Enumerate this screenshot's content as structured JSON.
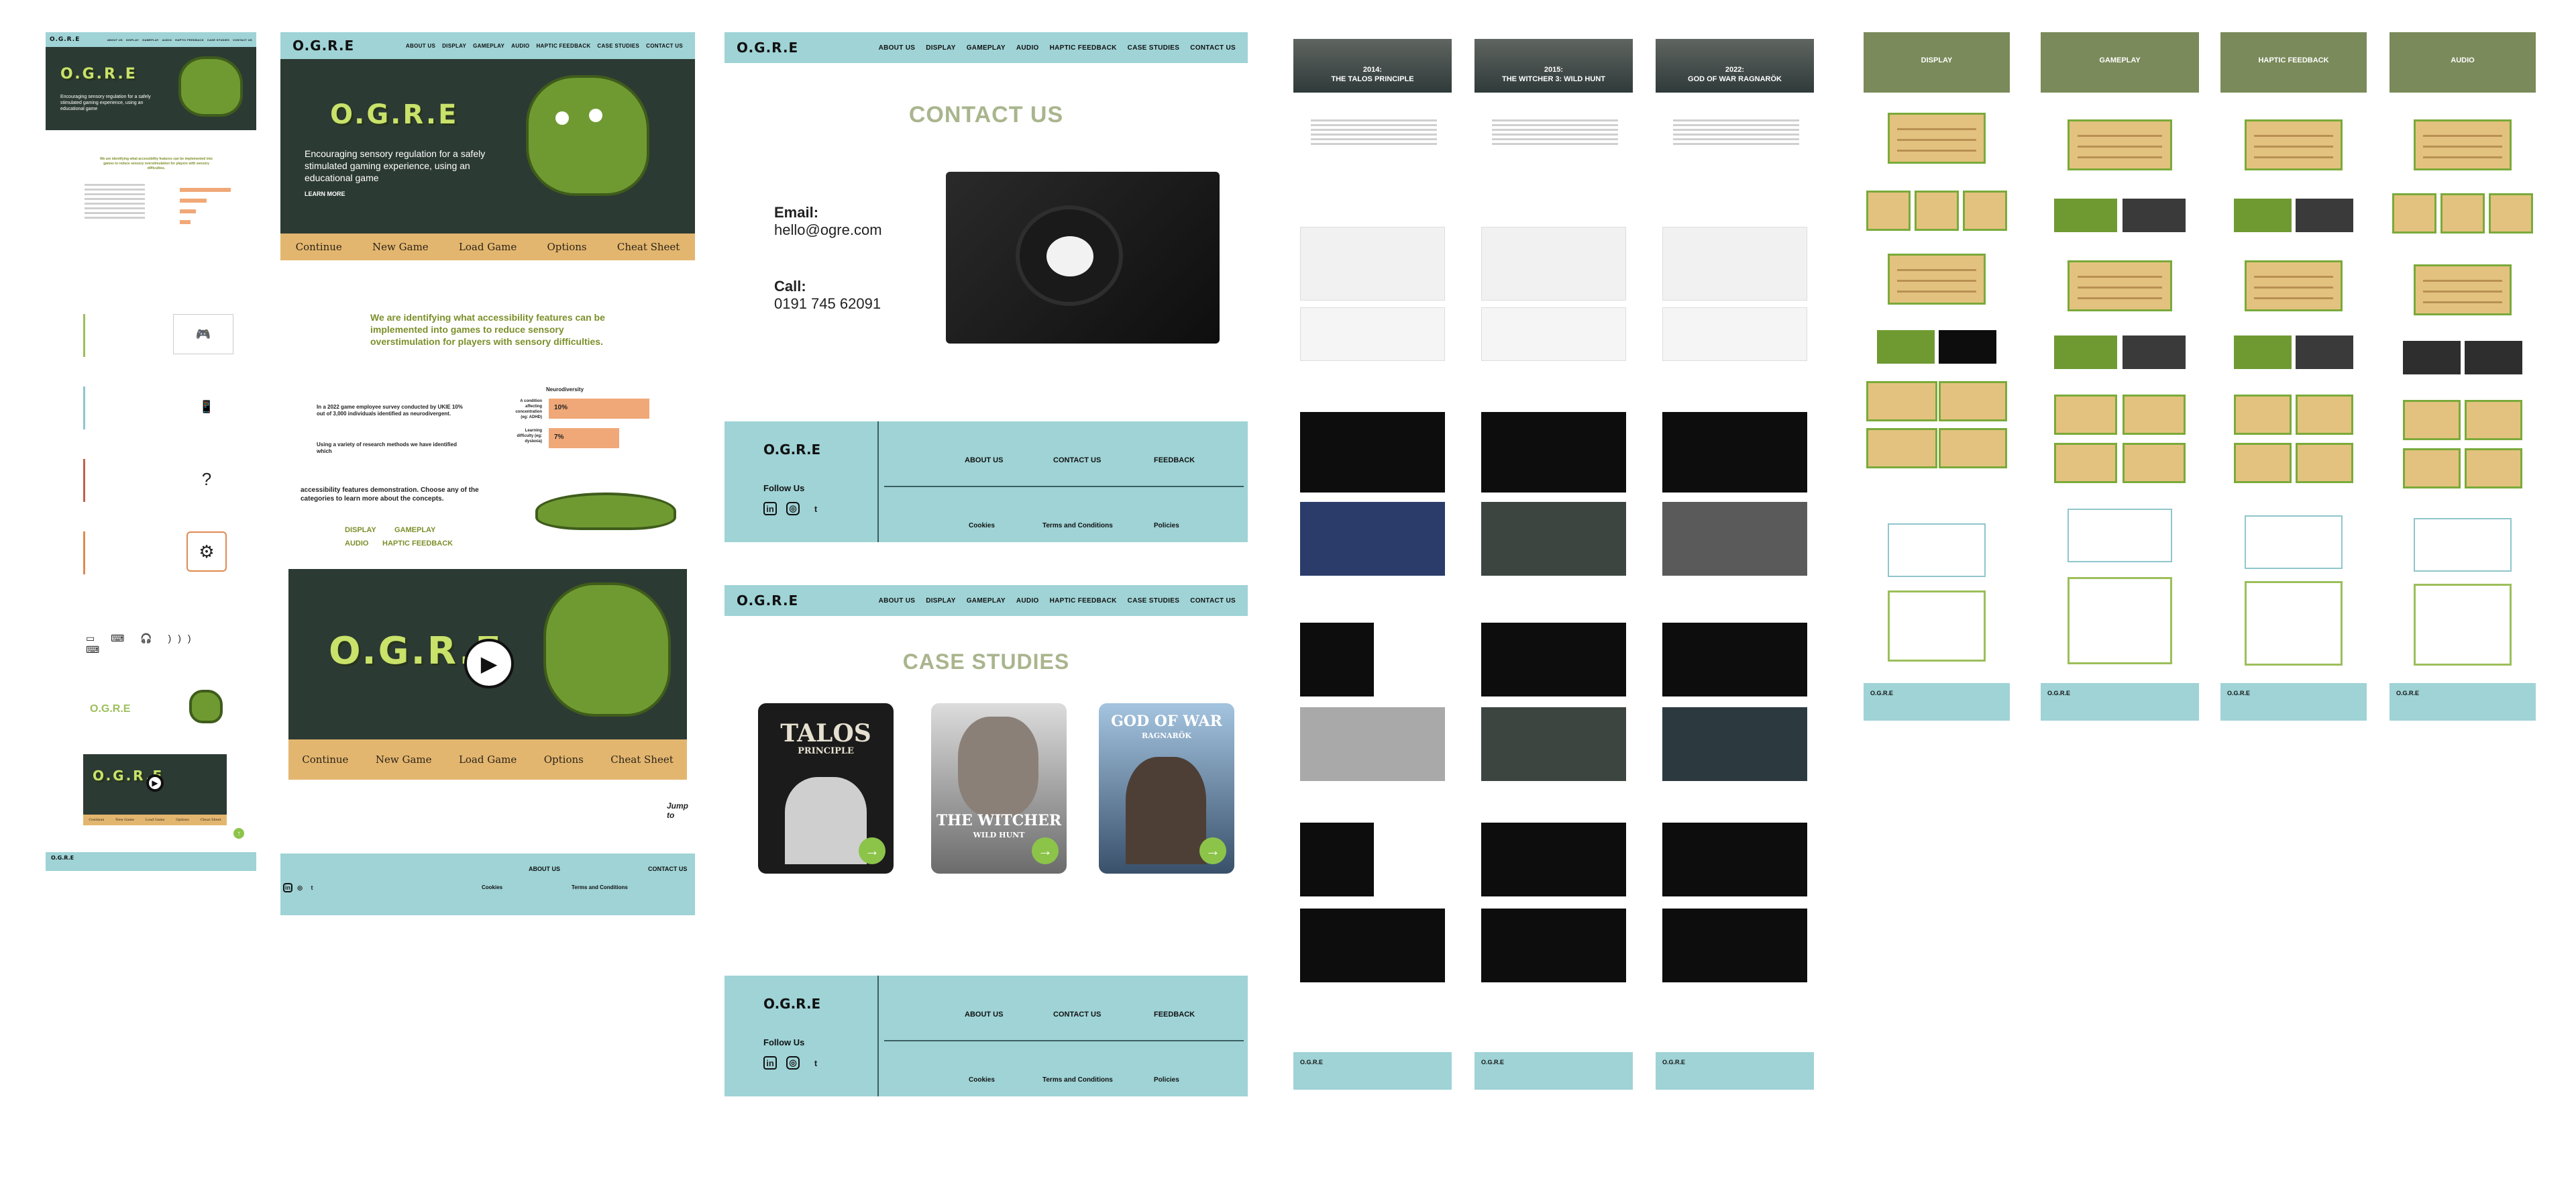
{
  "brand": {
    "logo": "O.G.R.E",
    "hero_title": "O.G.R.E"
  },
  "nav": [
    "ABOUT US",
    "DISPLAY",
    "GAMEPLAY",
    "AUDIO",
    "HAPTIC FEEDBACK",
    "CASE STUDIES",
    "CONTACT US"
  ],
  "hero": {
    "tagline": "Encouraging sensory regulation for a safely stimulated gaming experience, using an educational game",
    "learn_more": "LEARN MORE",
    "menu": [
      "Continue",
      "New Game",
      "Load Game",
      "Options",
      "Cheat Sheet"
    ]
  },
  "about": {
    "intro": "We are identifying what accessibility features can be implemented into games to reduce sensory overstimulation for players with sensory difficulties.",
    "survey_text": "In a 2022 game employee survey conducted by UKIE 10% out of 3,000 individuals identified as neurodivergent.",
    "method_text": "Using a variety of research methods we have identified which",
    "stat_header": "Neurodiversity",
    "stats": [
      {
        "label": "A condition affecting concentration (eg: ADHD)",
        "value": "10%",
        "pct": 10
      },
      {
        "label": "Learning difficulty (eg: dyslexia)",
        "value": "7%",
        "pct": 7
      }
    ],
    "stat_scale_max": 12,
    "categories_text": "accessibility features demonstration. Choose any of the categories to learn more about the concepts.",
    "category_links": [
      "DISPLAY",
      "GAMEPLAY",
      "AUDIO",
      "HAPTIC FEEDBACK"
    ],
    "jump": "Jump to"
  },
  "contact": {
    "title": "CONTACT US",
    "email_label": "Email:",
    "email": "hello@ogre.com",
    "call_label": "Call:",
    "phone": "0191 745 62091"
  },
  "case_studies": {
    "title": "CASE STUDIES",
    "games": [
      {
        "title": "TALOS",
        "subtitle": "PRINCIPLE"
      },
      {
        "title": "THE WITCHER",
        "subtitle": "WILD HUNT"
      },
      {
        "title": "GOD OF WAR",
        "subtitle": "RAGNARÖK"
      }
    ]
  },
  "footer": {
    "follow": "Follow Us",
    "links": [
      "ABOUT US",
      "CONTACT US",
      "FEEDBACK"
    ],
    "bottom_links": [
      "Cookies",
      "Terms and Conditions",
      "Policies"
    ],
    "social": [
      "in",
      "◎",
      "t"
    ]
  },
  "case_pages": [
    {
      "year": "2014:",
      "title": "THE TALOS PRINCIPLE"
    },
    {
      "year": "2015:",
      "title": "THE WITCHER 3: WILD HUNT"
    },
    {
      "year": "2022:",
      "title": "GOD OF WAR RAGNARÖK"
    }
  ],
  "category_pages": [
    "DISPLAY",
    "GAMEPLAY",
    "HAPTIC FEEDBACK",
    "AUDIO"
  ],
  "colors": {
    "teal": "#9fd3d6",
    "ogre_green": "#6f9a32",
    "tan": "#e3b66f",
    "salmon": "#f0a878",
    "olive": "#7b8f2a"
  }
}
